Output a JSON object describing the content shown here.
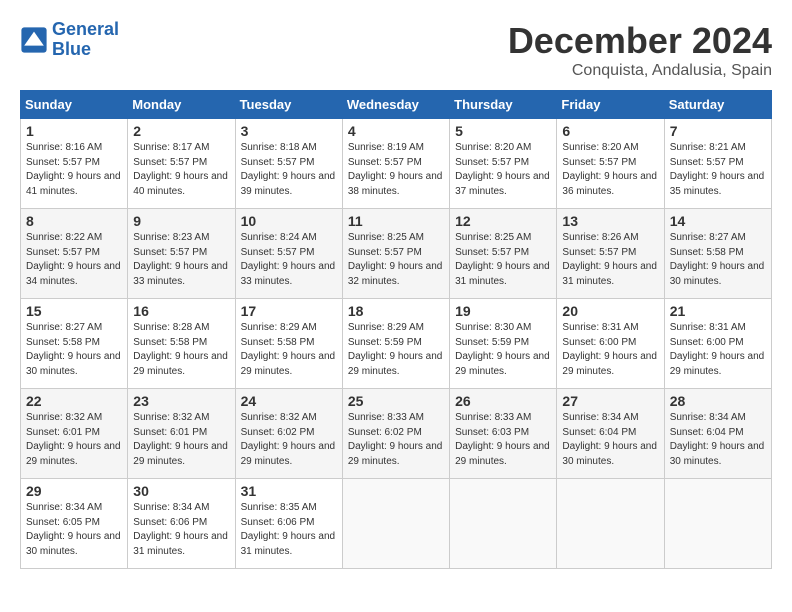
{
  "logo": {
    "line1": "General",
    "line2": "Blue"
  },
  "title": "December 2024",
  "location": "Conquista, Andalusia, Spain",
  "days_of_week": [
    "Sunday",
    "Monday",
    "Tuesday",
    "Wednesday",
    "Thursday",
    "Friday",
    "Saturday"
  ],
  "weeks": [
    [
      {
        "day": "1",
        "sunrise": "8:16 AM",
        "sunset": "5:57 PM",
        "daylight": "9 hours and 41 minutes."
      },
      {
        "day": "2",
        "sunrise": "8:17 AM",
        "sunset": "5:57 PM",
        "daylight": "9 hours and 40 minutes."
      },
      {
        "day": "3",
        "sunrise": "8:18 AM",
        "sunset": "5:57 PM",
        "daylight": "9 hours and 39 minutes."
      },
      {
        "day": "4",
        "sunrise": "8:19 AM",
        "sunset": "5:57 PM",
        "daylight": "9 hours and 38 minutes."
      },
      {
        "day": "5",
        "sunrise": "8:20 AM",
        "sunset": "5:57 PM",
        "daylight": "9 hours and 37 minutes."
      },
      {
        "day": "6",
        "sunrise": "8:20 AM",
        "sunset": "5:57 PM",
        "daylight": "9 hours and 36 minutes."
      },
      {
        "day": "7",
        "sunrise": "8:21 AM",
        "sunset": "5:57 PM",
        "daylight": "9 hours and 35 minutes."
      }
    ],
    [
      {
        "day": "8",
        "sunrise": "8:22 AM",
        "sunset": "5:57 PM",
        "daylight": "9 hours and 34 minutes."
      },
      {
        "day": "9",
        "sunrise": "8:23 AM",
        "sunset": "5:57 PM",
        "daylight": "9 hours and 33 minutes."
      },
      {
        "day": "10",
        "sunrise": "8:24 AM",
        "sunset": "5:57 PM",
        "daylight": "9 hours and 33 minutes."
      },
      {
        "day": "11",
        "sunrise": "8:25 AM",
        "sunset": "5:57 PM",
        "daylight": "9 hours and 32 minutes."
      },
      {
        "day": "12",
        "sunrise": "8:25 AM",
        "sunset": "5:57 PM",
        "daylight": "9 hours and 31 minutes."
      },
      {
        "day": "13",
        "sunrise": "8:26 AM",
        "sunset": "5:57 PM",
        "daylight": "9 hours and 31 minutes."
      },
      {
        "day": "14",
        "sunrise": "8:27 AM",
        "sunset": "5:58 PM",
        "daylight": "9 hours and 30 minutes."
      }
    ],
    [
      {
        "day": "15",
        "sunrise": "8:27 AM",
        "sunset": "5:58 PM",
        "daylight": "9 hours and 30 minutes."
      },
      {
        "day": "16",
        "sunrise": "8:28 AM",
        "sunset": "5:58 PM",
        "daylight": "9 hours and 29 minutes."
      },
      {
        "day": "17",
        "sunrise": "8:29 AM",
        "sunset": "5:58 PM",
        "daylight": "9 hours and 29 minutes."
      },
      {
        "day": "18",
        "sunrise": "8:29 AM",
        "sunset": "5:59 PM",
        "daylight": "9 hours and 29 minutes."
      },
      {
        "day": "19",
        "sunrise": "8:30 AM",
        "sunset": "5:59 PM",
        "daylight": "9 hours and 29 minutes."
      },
      {
        "day": "20",
        "sunrise": "8:31 AM",
        "sunset": "6:00 PM",
        "daylight": "9 hours and 29 minutes."
      },
      {
        "day": "21",
        "sunrise": "8:31 AM",
        "sunset": "6:00 PM",
        "daylight": "9 hours and 29 minutes."
      }
    ],
    [
      {
        "day": "22",
        "sunrise": "8:32 AM",
        "sunset": "6:01 PM",
        "daylight": "9 hours and 29 minutes."
      },
      {
        "day": "23",
        "sunrise": "8:32 AM",
        "sunset": "6:01 PM",
        "daylight": "9 hours and 29 minutes."
      },
      {
        "day": "24",
        "sunrise": "8:32 AM",
        "sunset": "6:02 PM",
        "daylight": "9 hours and 29 minutes."
      },
      {
        "day": "25",
        "sunrise": "8:33 AM",
        "sunset": "6:02 PM",
        "daylight": "9 hours and 29 minutes."
      },
      {
        "day": "26",
        "sunrise": "8:33 AM",
        "sunset": "6:03 PM",
        "daylight": "9 hours and 29 minutes."
      },
      {
        "day": "27",
        "sunrise": "8:34 AM",
        "sunset": "6:04 PM",
        "daylight": "9 hours and 30 minutes."
      },
      {
        "day": "28",
        "sunrise": "8:34 AM",
        "sunset": "6:04 PM",
        "daylight": "9 hours and 30 minutes."
      }
    ],
    [
      {
        "day": "29",
        "sunrise": "8:34 AM",
        "sunset": "6:05 PM",
        "daylight": "9 hours and 30 minutes."
      },
      {
        "day": "30",
        "sunrise": "8:34 AM",
        "sunset": "6:06 PM",
        "daylight": "9 hours and 31 minutes."
      },
      {
        "day": "31",
        "sunrise": "8:35 AM",
        "sunset": "6:06 PM",
        "daylight": "9 hours and 31 minutes."
      },
      null,
      null,
      null,
      null
    ]
  ]
}
